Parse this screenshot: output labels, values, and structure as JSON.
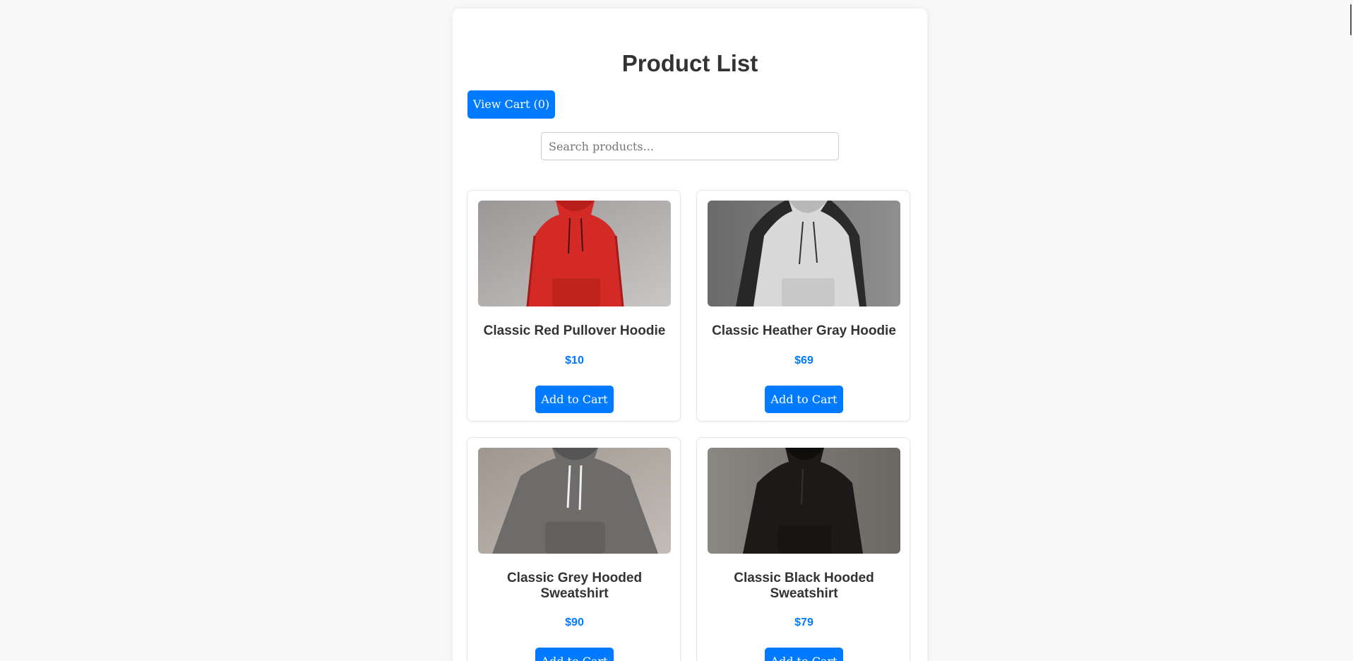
{
  "page": {
    "title": "Product List",
    "view_cart_label": "View Cart (0)",
    "search_placeholder": "Search products..."
  },
  "colors": {
    "accent": "#007bff",
    "background": "#f8f8f8",
    "card": "#ffffff",
    "text": "#333333"
  },
  "products": [
    {
      "name": "Classic Red Pullover Hoodie",
      "price": "$10",
      "button": "Add to Cart",
      "image": "red-hoodie-image"
    },
    {
      "name": "Classic Heather Gray Hoodie",
      "price": "$69",
      "button": "Add to Cart",
      "image": "heather-gray-hoodie-image"
    },
    {
      "name": "Classic Grey Hooded Sweatshirt",
      "price": "$90",
      "button": "Add to Cart",
      "image": "grey-hoodie-image"
    },
    {
      "name": "Classic Black Hooded Sweatshirt",
      "price": "$79",
      "button": "Add to Cart",
      "image": "black-hoodie-image"
    }
  ]
}
